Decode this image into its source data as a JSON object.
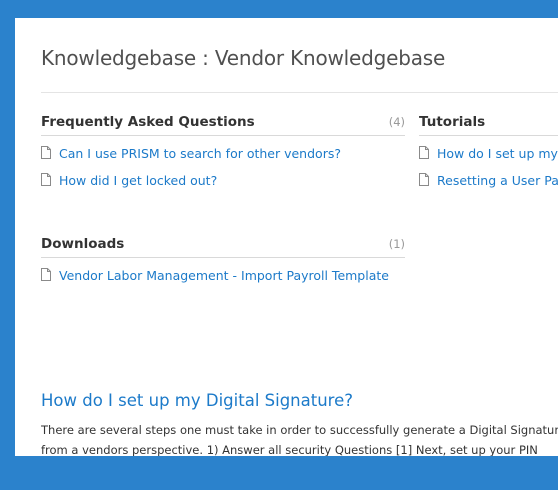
{
  "page": {
    "title": "Knowledgebase : Vendor Knowledgebase"
  },
  "faq": {
    "title": "Frequently Asked Questions",
    "count": "(4)",
    "items": [
      "Can I use PRISM to search for other vendors?",
      "How did I get locked out?"
    ]
  },
  "tutorials": {
    "title": "Tutorials",
    "items": [
      "How do I set up my Digital Signature?",
      "Resetting a User Password"
    ]
  },
  "downloads": {
    "title": "Downloads",
    "count": "(1)",
    "items": [
      "Vendor Labor Management - Import Payroll Template"
    ]
  },
  "article": {
    "title": "How do I set up my Digital Signature?",
    "line1": "There are several steps one must take in order to successfully generate a Digital Signature",
    "line2": "from a vendors perspective. 1) Answer all security Questions [1] Next, set up your PIN"
  },
  "colors": {
    "frame": "#2b82cc",
    "link": "#1c7ac9",
    "heading": "#333333",
    "count": "#999999"
  }
}
